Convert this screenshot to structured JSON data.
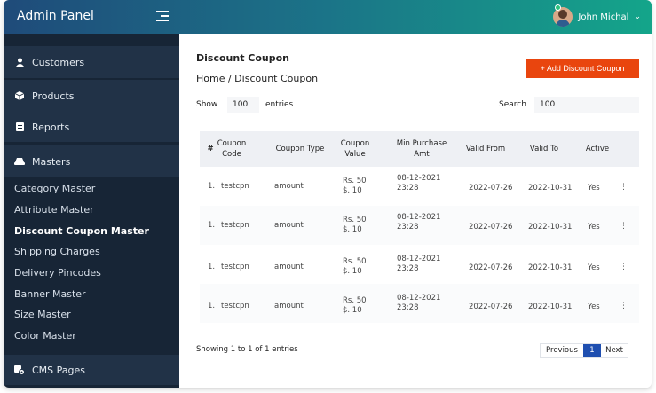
{
  "header": {
    "brand": "Admin Panel",
    "user_name": "John Michal",
    "user_chevron": "⌄"
  },
  "sidebar": {
    "customers": "Customers",
    "products": "Products",
    "reports": "Reports",
    "masters": "Masters",
    "sub_items": [
      "Category Master",
      "Attribute Master",
      "Discount Coupon Master",
      "Shipping Charges",
      "Delivery Pincodes",
      "Banner Master",
      "Size Master",
      "Color Master"
    ],
    "cms_pages": "CMS Pages"
  },
  "page": {
    "title": "Discount Coupon",
    "breadcrumb": "Home / Discount Coupon",
    "add_button": "+ Add Discount Coupon",
    "show_label": "Show",
    "entries_value": "100",
    "entries_label": "entries",
    "search_label": "Search",
    "search_value": "100"
  },
  "table": {
    "headers": {
      "num": "#",
      "code": "Coupon Code",
      "type": "Coupon Type",
      "value": "Coupon Value",
      "min": "Min Purchase Amt",
      "from": "Valid From",
      "to": "Valid To",
      "active": "Active"
    },
    "rows": [
      {
        "num": "1.",
        "code": "testcpn",
        "type": "amount",
        "value": "Rs. 50 $. 10",
        "min": "08-12-2021 23:28",
        "from": "2022-07-26",
        "to": "2022-10-31",
        "active": "Yes"
      },
      {
        "num": "1.",
        "code": "testcpn",
        "type": "amount",
        "value": "Rs. 50 $. 10",
        "min": "08-12-2021 23:28",
        "from": "2022-07-26",
        "to": "2022-10-31",
        "active": "Yes"
      },
      {
        "num": "1.",
        "code": "testcpn",
        "type": "amount",
        "value": "Rs. 50 $. 10",
        "min": "08-12-2021 23:28",
        "from": "2022-07-26",
        "to": "2022-10-31",
        "active": "Yes"
      },
      {
        "num": "1.",
        "code": "testcpn",
        "type": "amount",
        "value": "Rs. 50 $. 10",
        "min": "08-12-2021 23:28",
        "from": "2022-07-26",
        "to": "2022-10-31",
        "active": "Yes"
      }
    ]
  },
  "pagination": {
    "showing": "Showing 1 to 1 of 1 entries",
    "previous": "Previous",
    "current": "1",
    "next": "Next"
  },
  "colors": {
    "sidebar_bg": "#172536",
    "accent_button": "#e9450e",
    "pager_active": "#1f4fb0"
  }
}
